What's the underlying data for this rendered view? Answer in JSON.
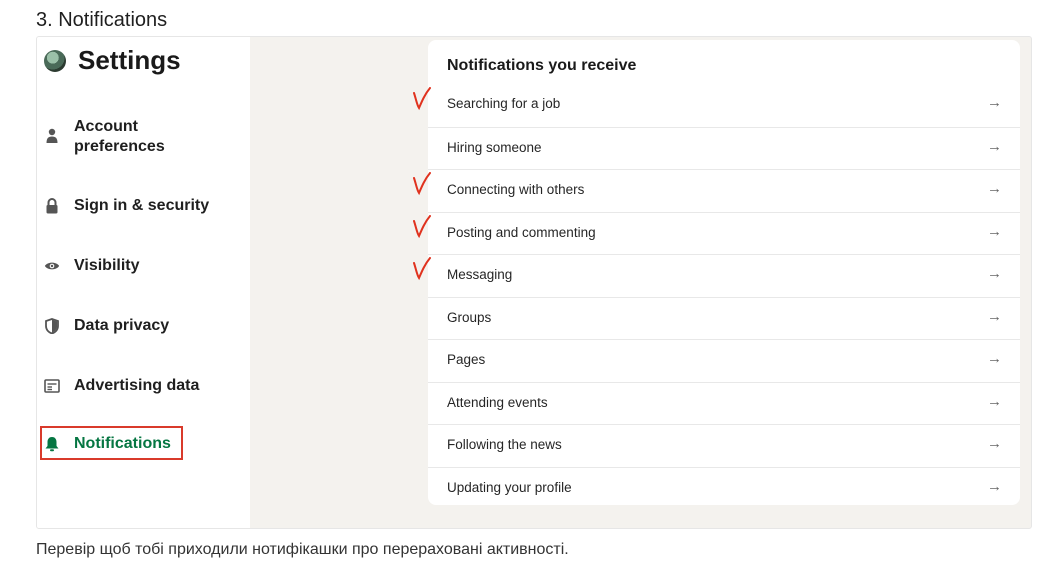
{
  "doc": {
    "heading": "3. Notifications",
    "caption": "Перевір щоб тобі приходили нотифікашки про перераховані активності."
  },
  "sidebar": {
    "title": "Settings",
    "items": [
      {
        "label": "Account\npreferences",
        "icon": "person-icon"
      },
      {
        "label": "Sign in & security",
        "icon": "lock-icon"
      },
      {
        "label": "Visibility",
        "icon": "eye-icon"
      },
      {
        "label": "Data privacy",
        "icon": "shield-icon"
      },
      {
        "label": "Advertising data",
        "icon": "ad-icon"
      },
      {
        "label": "Notifications",
        "icon": "bell-icon",
        "active": true
      }
    ]
  },
  "panel": {
    "title": "Notifications you receive",
    "rows": [
      {
        "label": "Searching for a job",
        "checked": true
      },
      {
        "label": "Hiring someone",
        "checked": false
      },
      {
        "label": "Connecting with others",
        "checked": true
      },
      {
        "label": "Posting and commenting",
        "checked": true
      },
      {
        "label": "Messaging",
        "checked": true
      },
      {
        "label": "Groups",
        "checked": false
      },
      {
        "label": "Pages",
        "checked": false
      },
      {
        "label": "Attending events",
        "checked": false
      },
      {
        "label": "Following the news",
        "checked": false
      },
      {
        "label": "Updating your profile",
        "checked": false
      }
    ],
    "arrow": "→"
  },
  "colors": {
    "active": "#057642",
    "highlight": "#d93a2b",
    "check": "#e0321e"
  }
}
